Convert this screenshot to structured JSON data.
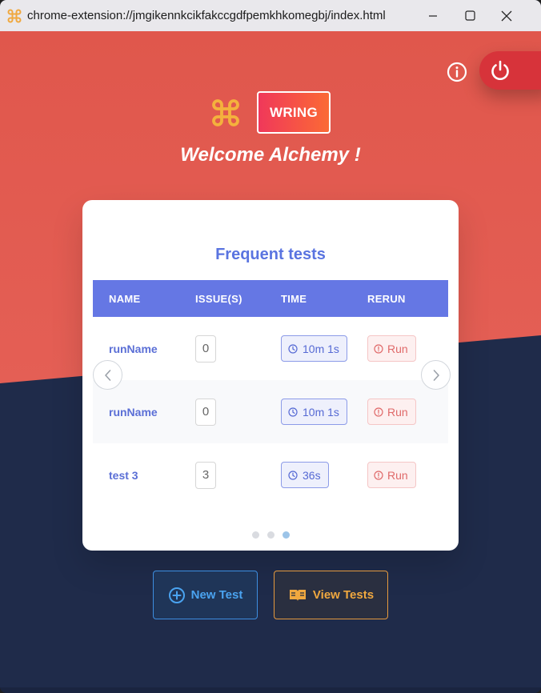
{
  "window": {
    "url": "chrome-extension://jmgikennkcikfakccgdfpemkhkomegbj/index.html"
  },
  "header": {
    "brand_label": "WRING",
    "welcome_text": "Welcome Alchemy !"
  },
  "frequent_tests": {
    "title": "Frequent tests",
    "columns": [
      "NAME",
      "ISSUE(S)",
      "TIME",
      "RERUN"
    ],
    "rows": [
      {
        "name": "runName",
        "issues": "0",
        "time": "10m 1s",
        "rerun": "Run"
      },
      {
        "name": "runName",
        "issues": "0",
        "time": "10m 1s",
        "rerun": "Run"
      },
      {
        "name": "test 3",
        "issues": "3",
        "time": "36s",
        "rerun": "Run"
      }
    ],
    "pagination": {
      "pages": 3,
      "active": 3
    }
  },
  "actions": {
    "new_test": "New Test",
    "view_tests": "View Tests"
  },
  "colors": {
    "top_background": "#e35c51",
    "bottom_background": "#1f2b4a",
    "brand_gradient_start": "#f0385a",
    "brand_gradient_end": "#fb6a35",
    "table_header": "#6577e4",
    "accent_blue": "#5a74e0",
    "power_button": "#d7333a"
  },
  "icons": {
    "favicon": "command-icon",
    "info": "info-icon",
    "power": "power-icon",
    "time": "clock-icon",
    "rerun": "alert-circle-icon",
    "new_test": "plus-circle-icon",
    "view_tests": "book-icon"
  }
}
